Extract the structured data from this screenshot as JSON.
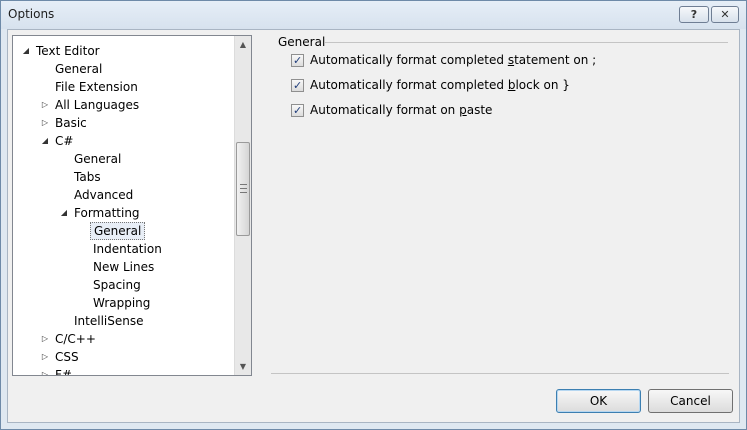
{
  "window": {
    "title": "Options",
    "help_label": "?",
    "close_label": "✕"
  },
  "tree": {
    "items": [
      {
        "label": "Text Editor",
        "level": 0,
        "arrow": "◢"
      },
      {
        "label": "General",
        "level": 1,
        "arrow": ""
      },
      {
        "label": "File Extension",
        "level": 1,
        "arrow": ""
      },
      {
        "label": "All Languages",
        "level": 1,
        "arrow": "▷"
      },
      {
        "label": "Basic",
        "level": 1,
        "arrow": "▷"
      },
      {
        "label": "C#",
        "level": 1,
        "arrow": "◢"
      },
      {
        "label": "General",
        "level": 2,
        "arrow": ""
      },
      {
        "label": "Tabs",
        "level": 2,
        "arrow": ""
      },
      {
        "label": "Advanced",
        "level": 2,
        "arrow": ""
      },
      {
        "label": "Formatting",
        "level": 2,
        "arrow": "◢"
      },
      {
        "label": "General",
        "level": 3,
        "arrow": "",
        "selected": true
      },
      {
        "label": "Indentation",
        "level": 3,
        "arrow": ""
      },
      {
        "label": "New Lines",
        "level": 3,
        "arrow": ""
      },
      {
        "label": "Spacing",
        "level": 3,
        "arrow": ""
      },
      {
        "label": "Wrapping",
        "level": 3,
        "arrow": ""
      },
      {
        "label": "IntelliSense",
        "level": 2,
        "arrow": ""
      },
      {
        "label": "C/C++",
        "level": 1,
        "arrow": "▷"
      },
      {
        "label": "CSS",
        "level": 1,
        "arrow": "▷"
      },
      {
        "label": "F#",
        "level": 1,
        "arrow": "▷"
      }
    ]
  },
  "panel": {
    "group_title": "General",
    "options": [
      {
        "pre": "Automatically format completed ",
        "key": "s",
        "post": "tatement on ;",
        "checked": true
      },
      {
        "pre": "Automatically format completed ",
        "key": "b",
        "post": "lock on }",
        "checked": true
      },
      {
        "pre": "Automatically format on ",
        "key": "p",
        "post": "aste",
        "checked": true
      }
    ]
  },
  "buttons": {
    "ok": "OK",
    "cancel": "Cancel"
  }
}
